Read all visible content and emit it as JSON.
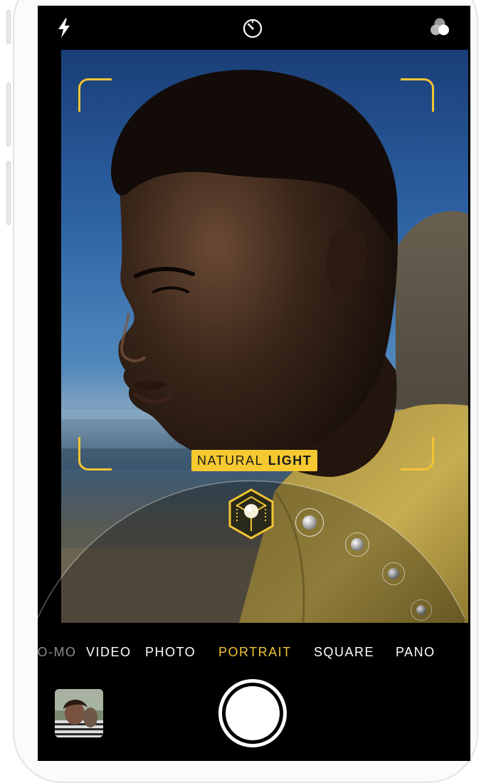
{
  "camera": {
    "top_bar": {
      "flash_icon": "flash-icon",
      "timer_icon": "timer-icon",
      "filters_icon": "filters-icon"
    },
    "lighting_effect": {
      "word1": "NATURAL",
      "word2": "LIGHT"
    },
    "modes": [
      {
        "label": "LO-MO"
      },
      {
        "label": "VIDEO"
      },
      {
        "label": "PHOTO"
      },
      {
        "label": "PORTRAIT"
      },
      {
        "label": "SQUARE"
      },
      {
        "label": "PANO"
      }
    ],
    "active_mode": "PORTRAIT",
    "colors": {
      "accent": "#f2c534",
      "badge_bg": "#f5c92f",
      "screen_bg": "#000000"
    }
  }
}
